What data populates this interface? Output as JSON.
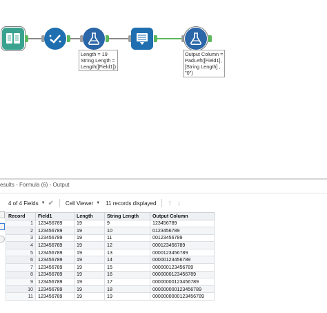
{
  "canvas": {
    "annotations": {
      "formula1": [
        "Length = 19",
        "String Length =",
        "Length([Field1])"
      ],
      "formula2": [
        "Output Column =",
        "PadLeft([Field1],",
        "[String Length] ,",
        "\"0\")"
      ]
    },
    "icons": {
      "input": "book-input-icon",
      "select": "select-check-icon",
      "formula1": "formula-flask-icon",
      "browse": "browse-icon",
      "formula2": "formula-flask-icon"
    },
    "colors": {
      "input": "#3aa390",
      "select": "#1f6fb0",
      "formula": "#2a66a8",
      "browse": "#1f6fb0",
      "connection_active": "#5bb85b"
    }
  },
  "results": {
    "header": "esults - Formula (6) - Output",
    "toolbar": {
      "fields": "4 of 4 Fields",
      "viewer": "Cell Viewer",
      "records": "11 records displayed"
    },
    "columns": [
      "Record",
      "Field1",
      "Length",
      "String Length",
      "Output Column"
    ],
    "rows": [
      [
        "1",
        "123456789",
        "19",
        "9",
        "123456789"
      ],
      [
        "2",
        "123456789",
        "19",
        "10",
        "0123456789"
      ],
      [
        "3",
        "123456789",
        "19",
        "11",
        "00123456789"
      ],
      [
        "4",
        "123456789",
        "19",
        "12",
        "000123456789"
      ],
      [
        "5",
        "123456789",
        "19",
        "13",
        "0000123456789"
      ],
      [
        "6",
        "123456789",
        "19",
        "14",
        "00000123456789"
      ],
      [
        "7",
        "123456789",
        "19",
        "15",
        "000000123456789"
      ],
      [
        "8",
        "123456789",
        "19",
        "16",
        "0000000123456789"
      ],
      [
        "9",
        "123456789",
        "19",
        "17",
        "00000000123456789"
      ],
      [
        "10",
        "123456789",
        "19",
        "18",
        "000000000123456789"
      ],
      [
        "11",
        "123456789",
        "19",
        "19",
        "0000000000123456789"
      ]
    ]
  }
}
